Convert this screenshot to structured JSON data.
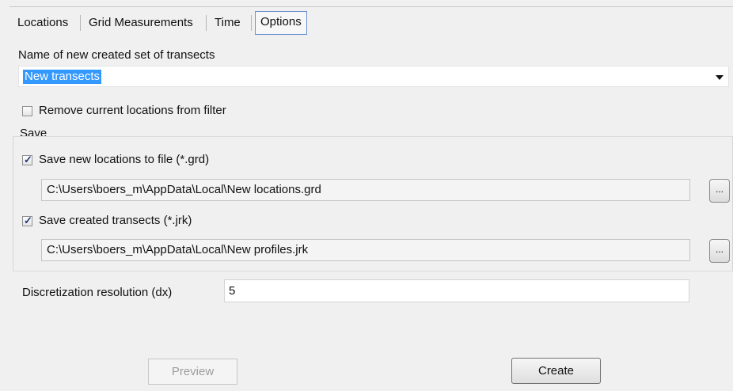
{
  "tabs": [
    {
      "label": "Locations"
    },
    {
      "label": "Grid Measurements"
    },
    {
      "label": "Time"
    },
    {
      "label": "Options"
    }
  ],
  "name_field": {
    "label": "Name of new created set of transects",
    "value": "New transects"
  },
  "remove_locations": {
    "label": "Remove current locations from filter",
    "checked": false
  },
  "save_group": {
    "title": "Save",
    "locations": {
      "label": "Save new locations to file (*.grd)",
      "checked": true,
      "path": "C:\\Users\\boers_m\\AppData\\Local\\New locations.grd",
      "browse_label": "..."
    },
    "transects": {
      "label": "Save created transects (*.jrk)",
      "checked": true,
      "path": "C:\\Users\\boers_m\\AppData\\Local\\New profiles.jrk",
      "browse_label": "..."
    }
  },
  "resolution": {
    "label": "Discretization resolution (dx)",
    "value": "5"
  },
  "buttons": {
    "preview": "Preview",
    "create": "Create"
  }
}
